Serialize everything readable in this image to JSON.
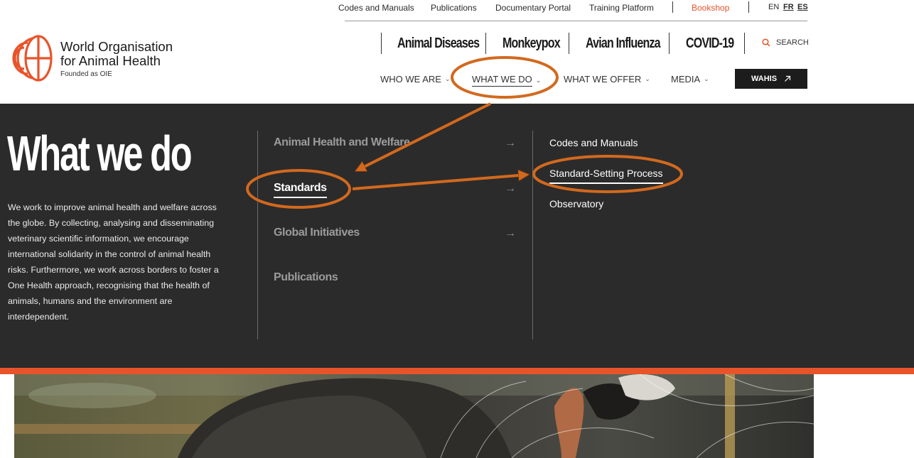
{
  "utility_nav": {
    "links": [
      "Codes and Manuals",
      "Publications",
      "Documentary Portal",
      "Training Platform"
    ],
    "bookshop": "Bookshop",
    "languages": [
      "EN",
      "FR",
      "ES"
    ]
  },
  "brand": {
    "name_line1": "World Organisation",
    "name_line2": "for Animal Health",
    "subtitle": "Founded as OIE",
    "accent_color": "#e8542a"
  },
  "highlights": [
    "Animal Diseases",
    "Monkeypox",
    "Avian Influenza",
    "COVID-19"
  ],
  "search": {
    "label": "SEARCH",
    "icon": "search-icon"
  },
  "main_nav": {
    "items": [
      "WHO WE ARE",
      "WHAT WE DO",
      "WHAT WE OFFER",
      "MEDIA"
    ],
    "active": "WHAT WE DO",
    "wahis_label": "WAHIS",
    "wahis_icon": "external-arrow-icon"
  },
  "mega_menu": {
    "title": "What we do",
    "description": "We work to improve animal health and welfare across the globe. By collecting, analysing and disseminating veterinary scientific information, we encourage international solidarity in the control of animal health risks. Furthermore, we work across borders to foster a One Health approach, recognising that the health of animals, humans and the environment are interdependent.",
    "categories": [
      "Animal Health and Welfare",
      "Standards",
      "Global Initiatives",
      "Publications"
    ],
    "active_category": "Standards",
    "subitems": [
      "Codes and Manuals",
      "Standard-Setting Process",
      "Observatory"
    ],
    "active_subitem": "Standard-Setting Process",
    "background_color": "#2b2b2b"
  },
  "annotation": {
    "color": "#d2691e"
  }
}
